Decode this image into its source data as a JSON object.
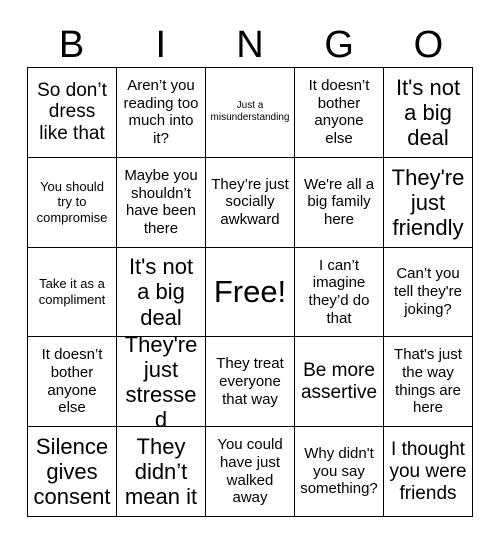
{
  "card": {
    "title_letters": [
      "B",
      "I",
      "N",
      "G",
      "O"
    ],
    "free_space_label": "Free!"
  },
  "grid": {
    "rows": [
      [
        {
          "text": "So don’t dress like that",
          "size": "fs-lg"
        },
        {
          "text": "Aren’t you reading too much into it?",
          "size": "fs-md"
        },
        {
          "text": "Just a misunderstanding",
          "size": "fs-xs"
        },
        {
          "text": "It doesn’t bother anyone else",
          "size": "fs-md"
        },
        {
          "text": "It's not a big deal",
          "size": "fs-xl"
        }
      ],
      [
        {
          "text": "You should try to compromise",
          "size": "fs-sm"
        },
        {
          "text": "Maybe you shouldn’t have been there",
          "size": "fs-md"
        },
        {
          "text": "They’re just socially awkward",
          "size": "fs-md"
        },
        {
          "text": "We're all a big family here",
          "size": "fs-md"
        },
        {
          "text": "They're just friendly",
          "size": "fs-xl"
        }
      ],
      [
        {
          "text": "Take it as a compliment",
          "size": "fs-sm"
        },
        {
          "text": "It's not a big deal",
          "size": "fs-xl"
        },
        {
          "text": "Free!",
          "size": "fs-free"
        },
        {
          "text": "I can’t imagine they’d do that",
          "size": "fs-md"
        },
        {
          "text": "Can’t you tell they're joking?",
          "size": "fs-md"
        }
      ],
      [
        {
          "text": "It doesn’t bother anyone else",
          "size": "fs-md"
        },
        {
          "text": "They're just stressed",
          "size": "fs-xl"
        },
        {
          "text": "They treat everyone that way",
          "size": "fs-md"
        },
        {
          "text": "Be more assertive",
          "size": "fs-lg"
        },
        {
          "text": "That's just the way things are here",
          "size": "fs-md"
        }
      ],
      [
        {
          "text": "Silence gives consent",
          "size": "fs-xl"
        },
        {
          "text": "They didn’t mean it",
          "size": "fs-xl"
        },
        {
          "text": "You could have just walked away",
          "size": "fs-md"
        },
        {
          "text": "Why didn't you say something?",
          "size": "fs-md"
        },
        {
          "text": "I thought you were friends",
          "size": "fs-lg"
        }
      ]
    ]
  },
  "colors": {
    "background": "#ffffff",
    "text": "#000000",
    "grid_line": "#000000"
  }
}
